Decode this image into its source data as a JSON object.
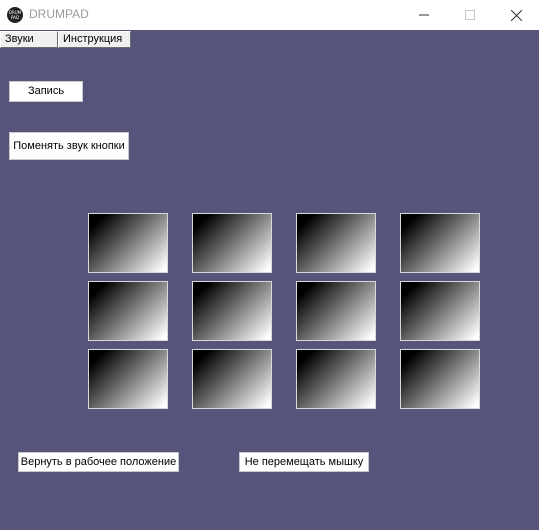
{
  "window": {
    "title": "DRUMPAD",
    "icon_text": "DRUM PAD",
    "icon": "drumpad-logo-icon"
  },
  "menu": {
    "items": [
      "Звуки",
      "Инструкция"
    ]
  },
  "buttons": {
    "record": "Запись",
    "change_sound": "Поменять звук кнопки",
    "reset_position": "Вернуть в рабочее положение",
    "no_mouse_move": "Не перемещать мышку"
  },
  "pads": {
    "rows": 3,
    "cols": 4
  },
  "colors": {
    "background": "#57547c",
    "titlebar": "#ffffff",
    "button_bg": "#ffffff"
  }
}
